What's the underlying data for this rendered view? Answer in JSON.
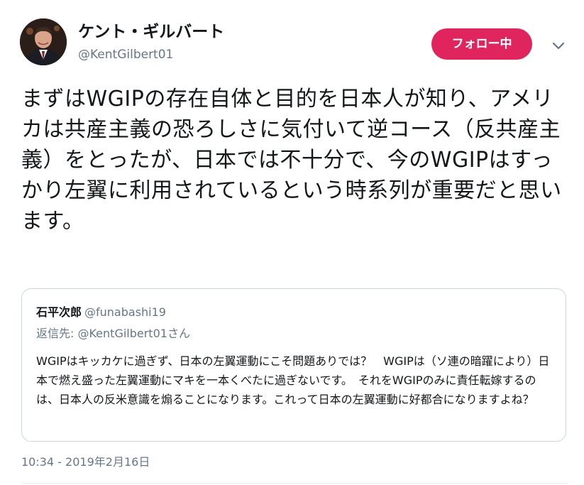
{
  "author": {
    "display_name": "ケント・ギルバート",
    "handle": "@KentGilbert01",
    "avatar_icon": "profile-photo"
  },
  "follow_button": {
    "label": "フォロー中",
    "color": "#e0245e"
  },
  "more_menu": {
    "icon": "chevron-down-icon"
  },
  "tweet": {
    "text": "まずはWGIPの存在自体と目的を日本人が知り、アメリカは共産主義の恐ろしさに気付いて逆コース（反共産主義）をとったが、日本では不十分で、今のWGIPはすっかり左翼に利用されているという時系列が重要だと思います。",
    "timestamp": "10:34 - 2019年2月16日"
  },
  "quoted_tweet": {
    "name": "石平次郎",
    "handle": "@funabashi19",
    "reply_prefix": "返信先: ",
    "reply_to": "@KentGilbert01さん",
    "text": "WGIPはキッカケに過ぎず、日本の左翼運動にこそ問題ありでは？　WGIPは（ソ連の暗躍により）日本で燃え盛った左翼運動にマキを一本くべたに過ぎないです。　それをWGIPのみに責任転嫁するのは、日本人の反米意識を煽ることになります。これって日本の左翼運動に好都合になりますよね？"
  },
  "colors": {
    "text_primary": "#14171a",
    "text_secondary": "#657786",
    "border": "#ccd6dd"
  }
}
